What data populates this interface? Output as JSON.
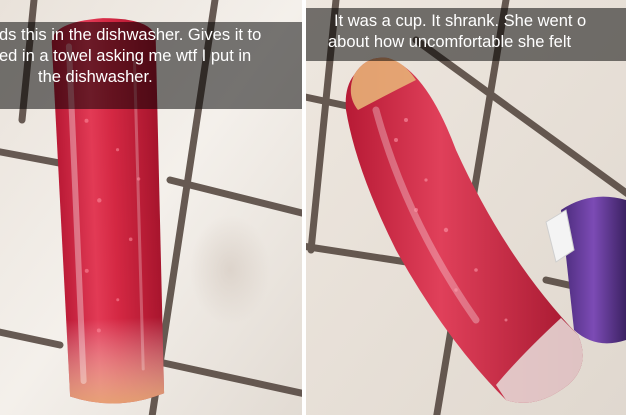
{
  "snaps": [
    {
      "caption_lines": [
        "ds this in the dishwasher. Gives it to",
        "ed in a towel asking me wtf I put in",
        "the dishwasher."
      ]
    },
    {
      "caption_lines": [
        "It was a cup. It shrank. She went o",
        "about how uncomfortable she felt"
      ]
    }
  ],
  "colors": {
    "tile": "#f1ece6",
    "grout": "#4e4038",
    "liquid": "#c8203a",
    "caption_bg": "rgba(0,0,0,0.52)"
  }
}
